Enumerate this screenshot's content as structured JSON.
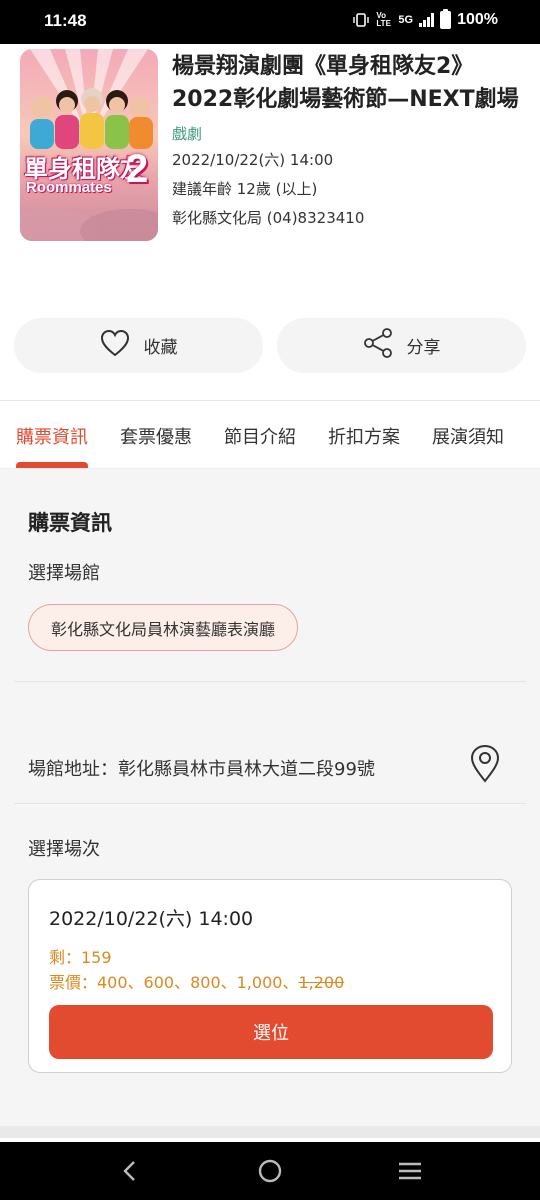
{
  "status_bar": {
    "time": "11:48",
    "network": "5G",
    "volte": "Vo LTE",
    "battery": "100%"
  },
  "event": {
    "poster_title_zh": "單身租隊友",
    "poster_title_en": "Roommates",
    "poster_number": "2",
    "title": "楊景翔演劇團《單身租隊友2》2022彰化劇場藝術節—NEXT劇場",
    "category": "戲劇",
    "datetime": "2022/10/22(六) 14:00",
    "age": "建議年齡  12歲 (以上)",
    "organizer": "彰化縣文化局 (04)8323410"
  },
  "actions": {
    "favorite_label": "收藏",
    "share_label": "分享"
  },
  "tabs": [
    {
      "label": "購票資訊",
      "active": true
    },
    {
      "label": "套票優惠",
      "active": false
    },
    {
      "label": "節目介紹",
      "active": false
    },
    {
      "label": "折扣方案",
      "active": false
    },
    {
      "label": "展演須知",
      "active": false
    }
  ],
  "ticket_info": {
    "section_title": "購票資訊",
    "select_venue_label": "選擇場館",
    "venue": "彰化縣文化局員林演藝廳表演廳",
    "address": "場館地址：彰化縣員林市員林大道二段99號",
    "select_session_label": "選擇場次",
    "session": {
      "datetime": "2022/10/22(六) 14:00",
      "remaining": "剩：159",
      "price_prefix": "票價：400、600、800、1,000、",
      "price_soldout": "1,200",
      "select_label": "選位"
    }
  },
  "colors": {
    "accent": "#e24b2f",
    "category": "#3d9a7a",
    "price": "#d98a22"
  },
  "icons": {
    "favorite": "heart-icon",
    "share": "share-icon",
    "map": "map-pin-icon",
    "back": "back-icon",
    "home": "home-icon",
    "recents": "recents-icon"
  }
}
